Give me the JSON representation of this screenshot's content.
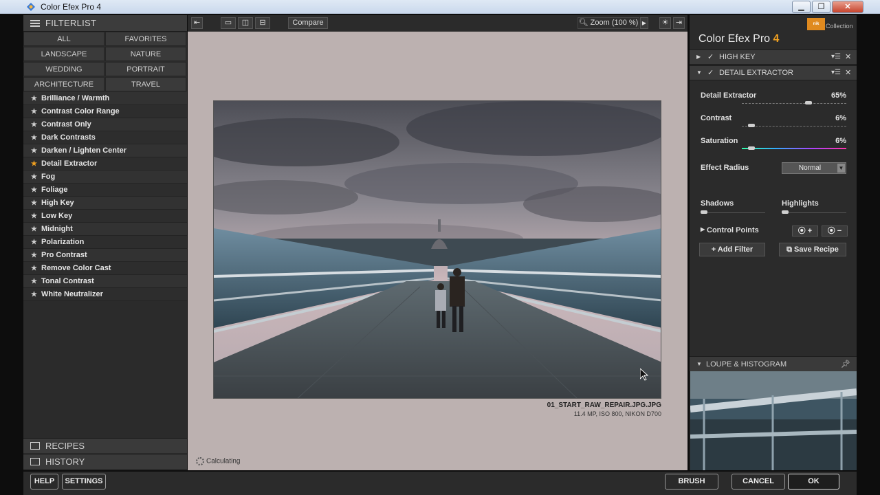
{
  "window": {
    "title": "Color Efex Pro 4",
    "minimize": "▁",
    "restore": "❐",
    "close": "✕"
  },
  "left_panel": {
    "header": "FILTERLIST",
    "categories": [
      "ALL",
      "FAVORITES",
      "LANDSCAPE",
      "NATURE",
      "WEDDING",
      "PORTRAIT",
      "ARCHITECTURE",
      "TRAVEL"
    ],
    "filters": [
      {
        "label": "Brilliance / Warmth",
        "favorite": false
      },
      {
        "label": "Contrast Color Range",
        "favorite": false
      },
      {
        "label": "Contrast Only",
        "favorite": false
      },
      {
        "label": "Dark Contrasts",
        "favorite": false
      },
      {
        "label": "Darken / Lighten Center",
        "favorite": false
      },
      {
        "label": "Detail Extractor",
        "favorite": true
      },
      {
        "label": "Fog",
        "favorite": false
      },
      {
        "label": "Foliage",
        "favorite": false
      },
      {
        "label": "High Key",
        "favorite": false
      },
      {
        "label": "Low Key",
        "favorite": false
      },
      {
        "label": "Midnight",
        "favorite": false
      },
      {
        "label": "Polarization",
        "favorite": false
      },
      {
        "label": "Pro Contrast",
        "favorite": false
      },
      {
        "label": "Remove Color Cast",
        "favorite": false
      },
      {
        "label": "Tonal Contrast",
        "favorite": false
      },
      {
        "label": "White Neutralizer",
        "favorite": false
      }
    ],
    "recipes": "RECIPES",
    "history": "HISTORY"
  },
  "toolbar": {
    "compare": "Compare",
    "zoom": "Zoom (100 %)"
  },
  "image": {
    "filename": "01_START_RAW_REPAIR.JPG.JPG",
    "meta": "11.4 MP, ISO 800, NIKON D700",
    "status": "Calculating"
  },
  "right_panel": {
    "collection": "Collection",
    "logo_text": "nik",
    "title": "Color Efex Pro",
    "version": "4",
    "filter1": {
      "name": "HIGH KEY"
    },
    "filter2": {
      "name": "DETAIL EXTRACTOR"
    },
    "params": {
      "detail_extractor": {
        "label": "Detail Extractor",
        "value": "65%",
        "level": 0.65
      },
      "contrast": {
        "label": "Contrast",
        "value": "6%",
        "level": 0.06
      },
      "saturation": {
        "label": "Saturation",
        "value": "6%",
        "level": 0.06
      },
      "effect_radius": {
        "label": "Effect Radius",
        "value": "Normal"
      },
      "shadows": {
        "label": "Shadows",
        "level": 0.0
      },
      "highlights": {
        "label": "Highlights",
        "level": 0.0
      }
    },
    "control_points": "Control Points",
    "add_filter": "+ Add Filter",
    "save_recipe": "Save Recipe",
    "loupe": "LOUPE & HISTOGRAM"
  },
  "bottom": {
    "help": "HELP",
    "settings": "SETTINGS",
    "brush": "BRUSH",
    "cancel": "CANCEL",
    "ok": "OK"
  }
}
